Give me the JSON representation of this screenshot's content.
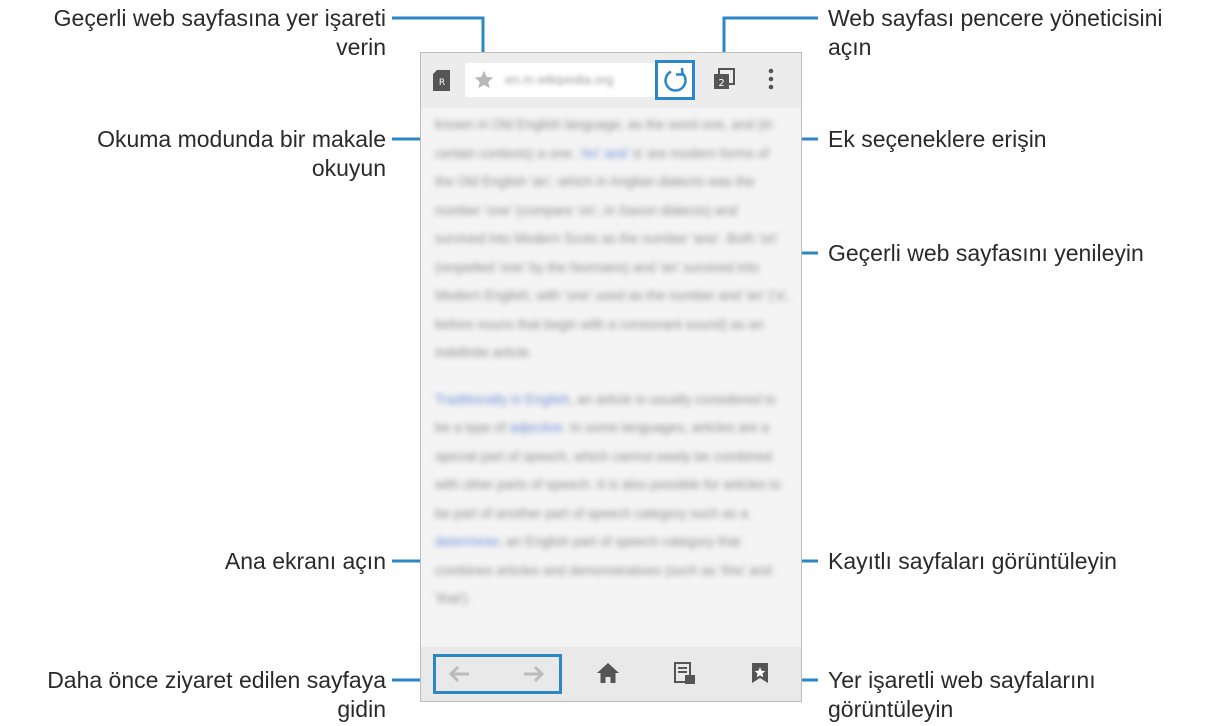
{
  "callouts": {
    "bookmark_current": [
      "Geçerli web sayfasına yer işareti",
      "verin"
    ],
    "reading_mode": [
      "Okuma modunda bir makale",
      "okuyun"
    ],
    "window_manager": [
      "Web sayfası pencere yöneticisini",
      "açın"
    ],
    "more_options": "Ek seçeneklere erişin",
    "refresh": "Geçerli web sayfasını yenileyin",
    "home": "Ana ekranı açın",
    "saved_pages": "Kayıtlı sayfaları görüntüleyin",
    "previous_pages": [
      "Daha önce ziyaret edilen sayfaya",
      "gidin"
    ],
    "bookmarks": [
      "Yer işaretli web sayfalarını",
      "görüntüleyin"
    ]
  },
  "browser": {
    "url": "en.m.wikipedia.org",
    "reader_badge": "R",
    "tab_count": "2",
    "content": [
      {
        "segments": [
          {
            "t": "known in Old English language, as the word ",
            "link": false
          },
          {
            "t": "one, and (in certain contexts) a one.",
            "link": false
          },
          {
            "t": " 'An' and ",
            "link": true
          },
          {
            "t": "'a' are modern forms of the Old English 'an', which in Anglian dialects was the number 'one' (compare 'on', in Saxon dialects) and survived into Modern Scots as the number 'ane'. Both 'on' (respelled 'one' by the Normans) and 'an' survived into Modern English, with 'one' used as the number and 'an' ('a', before nouns that begin with a consonant sound) as an indefinite article.",
            "link": false
          }
        ]
      },
      {
        "segments": [
          {
            "t": "Traditionally in English",
            "link": true
          },
          {
            "t": ", an article is usually considered to be a type of ",
            "link": false
          },
          {
            "t": "adjective",
            "link": true
          },
          {
            "t": ". In some languages, articles are a special part of speech, which cannot easily be combined with other parts of speech. It is also possible for articles to be part of another part of speech category such as a ",
            "link": false
          },
          {
            "t": "determiner",
            "link": true
          },
          {
            "t": ", an English part of speech category that combines articles and demonstratives (such as 'this' and 'that').",
            "link": false
          }
        ]
      }
    ]
  },
  "colors": {
    "accent": "#2c87c7",
    "icon": "#555555",
    "icon_disabled": "#bbbbbb"
  }
}
